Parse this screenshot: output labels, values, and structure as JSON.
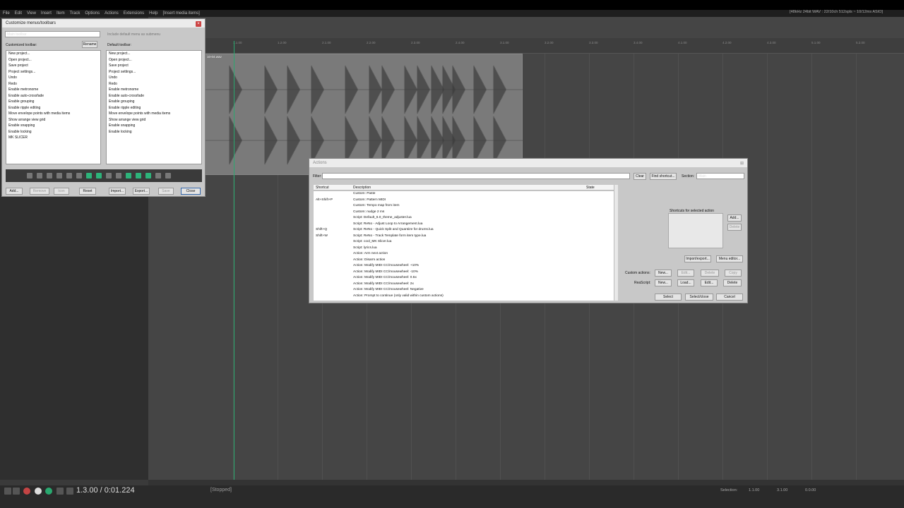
{
  "menubar": [
    "File",
    "Edit",
    "View",
    "Insert",
    "Item",
    "Track",
    "Options",
    "Actions",
    "Extensions",
    "Help",
    "[Insert media items]"
  ],
  "title_info": "[48kHz 24bit WAV : 22/10ch 512spls ~ 10/12ms ASIO]",
  "ruler_ticks": [
    "1.1.00",
    "1.2.00",
    "2.1.00",
    "2.2.00",
    "2.3.00",
    "2.4.00",
    "3.1.00",
    "3.2.00",
    "3.3.00",
    "3.4.00",
    "4.1.00",
    "4.2.00",
    "4.3.00",
    "5.1.00",
    "5.2.00"
  ],
  "item_label": "10-04.wav",
  "customize": {
    "title": "Customize menus/toolbars",
    "combo": "Main toolbar",
    "include_default": "Include default menu as submenu",
    "customized_label": "Customized toolbar:",
    "rename": "Rename",
    "default_label": "Default toolbar:",
    "left_items": [
      "New project...",
      "Open project...",
      "Save project",
      "Project settings...",
      "Undo",
      "Redo",
      "Enable metronome",
      "Enable auto-crossfade",
      "Enable grouping",
      "Enable ripple editing",
      "Move envelope points with media items",
      "Show arrange view grid",
      "Enable snapping",
      "Enable locking",
      "MK SLICER"
    ],
    "right_items": [
      "New project...",
      "Open project...",
      "Save project",
      "Project settings...",
      "Undo",
      "Redo",
      "Enable metronome",
      "Enable auto-crossfade",
      "Enable grouping",
      "Enable ripple editing",
      "Move envelope points with media items",
      "Show arrange view grid",
      "Enable snapping",
      "Enable locking"
    ],
    "buttons": {
      "add": "Add...",
      "remove": "Remove",
      "icon": "Icon",
      "reset": "Reset",
      "import": "Import...",
      "export": "Export...",
      "save": "Save",
      "close": "Close"
    }
  },
  "actions": {
    "title": "Actions",
    "filter_label": "Filter:",
    "clear": "Clear",
    "find_shortcut": "Find shortcut...",
    "section_label": "Section:",
    "section_value": "Main",
    "col_shortcut": "Shortcut",
    "col_description": "Description",
    "col_state": "State",
    "rows": [
      {
        "sc": "",
        "d": "Custom: Paste"
      },
      {
        "sc": "Alt+Shift+P",
        "d": "Custom: Pattern MIDI"
      },
      {
        "sc": "",
        "d": "Custom: Tempo map from item"
      },
      {
        "sc": "",
        "d": "Custom: nudge 2 ms"
      },
      {
        "sc": "",
        "d": "Script: Default_6.0_theme_adjuster.lua"
      },
      {
        "sc": "",
        "d": "Script: ReNo - Adjust Loop to Arrangement.lua"
      },
      {
        "sc": "Shift+Q",
        "d": "Script: ReNo - Quick Split and Quantize for drums.lua"
      },
      {
        "sc": "Shift+W",
        "d": "Script: ReNo - Track Template form item type.lua"
      },
      {
        "sc": "",
        "d": "Script: cool_MK Slicer.lua"
      },
      {
        "sc": "",
        "d": "Script: lyrics.lua"
      },
      {
        "sc": "",
        "d": "Action: Arm next action"
      },
      {
        "sc": "",
        "d": "Action: Disarm action"
      },
      {
        "sc": "",
        "d": "Action: Modify MIDI CC/mousewheel: +10%"
      },
      {
        "sc": "",
        "d": "Action: Modify MIDI CC/mousewheel: -10%"
      },
      {
        "sc": "",
        "d": "Action: Modify MIDI CC/mousewheel: 0.5x"
      },
      {
        "sc": "",
        "d": "Action: Modify MIDI CC/mousewheel: 2x"
      },
      {
        "sc": "",
        "d": "Action: Modify MIDI CC/mousewheel: Negative"
      },
      {
        "sc": "",
        "d": "Action: Prompt to continue (only valid within custom actions)"
      }
    ],
    "shortcuts_group": "Shortcuts for selected action",
    "add": "Add...",
    "delete": "Delete",
    "import_export": "Import/export...",
    "menu_editor": "Menu editor...",
    "custom_actions_label": "Custom actions:",
    "reascript_label": "ReaScript:",
    "ca_new": "New...",
    "ca_edit": "Edit...",
    "ca_delete": "Delete",
    "ca_copy": "Copy",
    "rs_new": "New...",
    "rs_load": "Load...",
    "rs_edit": "Edit...",
    "rs_delete": "Delete",
    "select": "Select",
    "select_close": "Select/close",
    "cancel": "Cancel"
  },
  "transport": {
    "time": "1.3.00 / 0:01.224",
    "state": "[Stopped]",
    "selection": "Selection:",
    "sel1": "1.1.00",
    "sel2": "3.1.00",
    "sel3": "0.0.00"
  },
  "colors": {
    "accent": "#29a86f",
    "record": "#c44444"
  }
}
